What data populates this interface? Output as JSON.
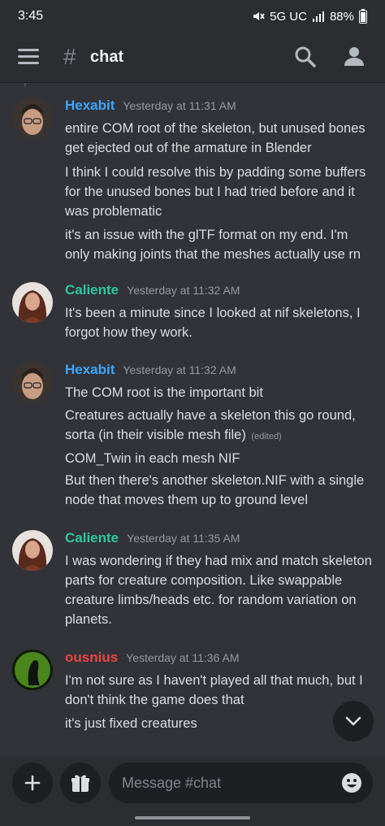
{
  "status_bar": {
    "time": "3:45",
    "network": "5G UC",
    "battery": "88%"
  },
  "header": {
    "channel_name": "chat",
    "icons": [
      "menu-icon",
      "hash-icon",
      "search-icon",
      "members-icon"
    ]
  },
  "colors": {
    "Hexabit": "#3ea6ff",
    "Caliente": "#2dc7a0",
    "ousnius": "#f0453f"
  },
  "messages": [
    {
      "author": "Hexabit",
      "timestamp": "Yesterday at 11:31 AM",
      "lines": [
        "entire COM root of the skeleton, but unused bones get ejected out of the armature in Blender",
        "I think I could resolve this by padding some buffers for the unused bones but I had tried before and it was problematic",
        "it's an issue with the glTF format on my end.  I'm only making joints that the meshes actually use rn"
      ]
    },
    {
      "author": "Caliente",
      "timestamp": "Yesterday at 11:32 AM",
      "lines": [
        "It's been a minute since I looked at nif skeletons, I forgot how they work."
      ]
    },
    {
      "author": "Hexabit",
      "timestamp": "Yesterday at 11:32 AM",
      "lines": [
        "The COM root is the important bit",
        "Creatures actually have a skeleton this go round, sorta (in their visible mesh file)",
        "COM_Twin in each mesh NIF",
        "But then there's another skeleton.NIF with a single node that moves them up to ground level"
      ],
      "edited_label": "(edited)"
    },
    {
      "author": "Caliente",
      "timestamp": "Yesterday at 11:35 AM",
      "lines": [
        "I was wondering if they had mix and match skeleton parts for creature composition.  Like swappable creature limbs/heads etc. for random variation on planets."
      ]
    },
    {
      "author": "ousnius",
      "timestamp": "Yesterday at 11:36 AM",
      "lines": [
        "I'm not sure as I haven't played all that much, but I don't think the game does that",
        "it's just fixed creatures"
      ]
    }
  ],
  "composer": {
    "placeholder": "Message #chat",
    "icons": [
      "plus-icon",
      "gift-icon",
      "emoji-icon"
    ]
  },
  "scroll_button_icon": "chevron-down-icon"
}
